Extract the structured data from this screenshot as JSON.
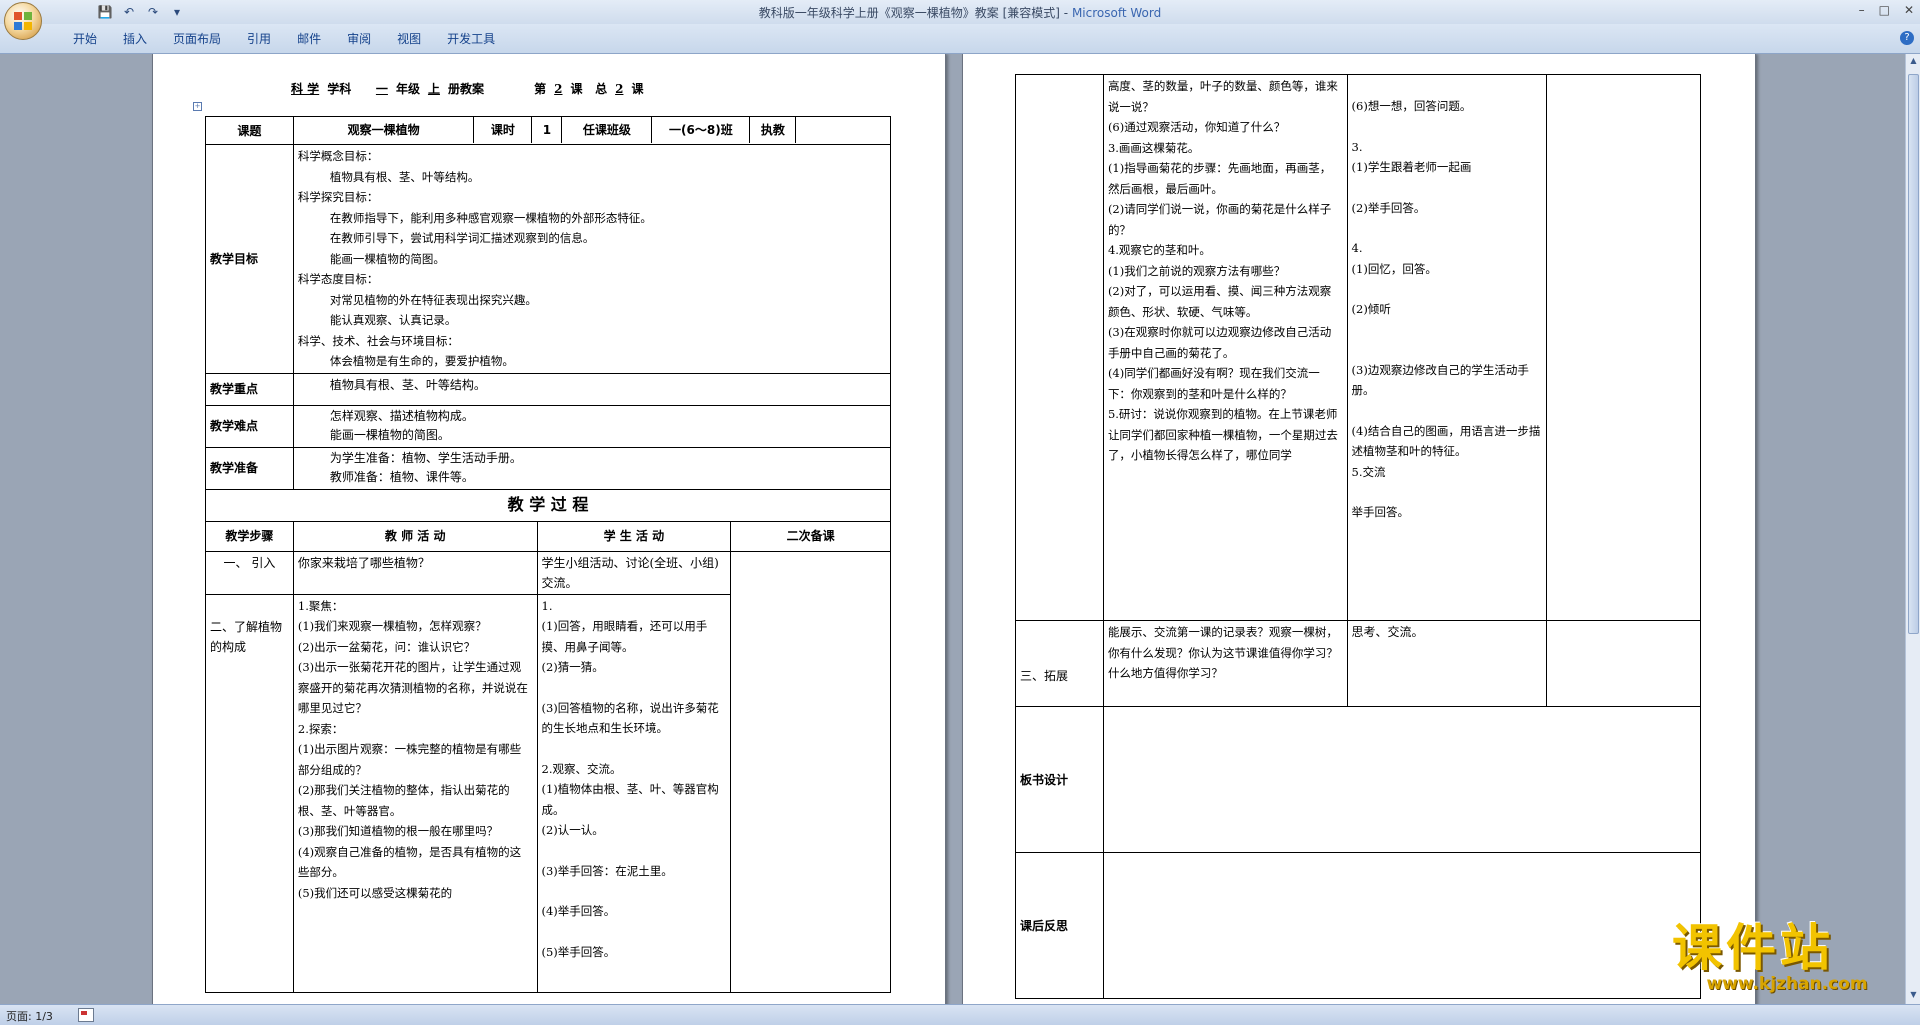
{
  "window": {
    "title_doc": "教科版一年级科学上册《观察一棵植物》教案 [兼容模式]",
    "title_sep": " - ",
    "title_app": "Microsoft Word",
    "minimize": "–",
    "maximize": "□",
    "close": "✕"
  },
  "qat": {
    "save": "💾",
    "undo": "↶",
    "redo": "↷",
    "more": "▾"
  },
  "ribbon": {
    "tabs": [
      "开始",
      "插入",
      "页面布局",
      "引用",
      "邮件",
      "审阅",
      "视图",
      "开发工具"
    ],
    "help": "?"
  },
  "doc_header": {
    "subject": "科 学",
    "subject_label": "学科",
    "grade": "一",
    "grade_label": "年级",
    "term": "上",
    "term_label": "册教案",
    "lesson_prefix": "第",
    "lesson_no": "2",
    "lesson_label": "课",
    "total_prefix": "总",
    "total_no": "2",
    "total_label": "课"
  },
  "table1": {
    "topic_label": "课题",
    "topic": "观察一棵植物",
    "hours_label": "课时",
    "hours": "1",
    "class_label": "任课班级",
    "class": "一(6～8)班",
    "teacher_label": "执教",
    "goals_label": "教学目标",
    "goals": [
      {
        "text": "科学概念目标：",
        "indent": false
      },
      {
        "text": "植物具有根、茎、叶等结构。",
        "indent": true
      },
      {
        "text": "科学探究目标：",
        "indent": false
      },
      {
        "text": "在教师指导下，能利用多种感官观察一棵植物的外部形态特征。",
        "indent": true
      },
      {
        "text": "在教师引导下，尝试用科学词汇描述观察到的信息。",
        "indent": true
      },
      {
        "text": "能画一棵植物的简图。",
        "indent": true
      },
      {
        "text": "科学态度目标：",
        "indent": false
      },
      {
        "text": "对常见植物的外在特征表现出探究兴趣。",
        "indent": true
      },
      {
        "text": "能认真观察、认真记录。",
        "indent": true
      },
      {
        "text": "科学、技术、社会与环境目标：",
        "indent": false
      },
      {
        "text": "体会植物是有生命的，要爱护植物。",
        "indent": true
      }
    ],
    "key_label": "教学重点",
    "key": [
      "植物具有根、茎、叶等结构。"
    ],
    "difficult_label": "教学难点",
    "difficult": [
      "怎样观察、描述植物构成。",
      "能画一棵植物的简图。"
    ],
    "prep_label": "教学准备",
    "prep": [
      "为学生准备：植物、学生活动手册。",
      "教师准备：植物、课件等。"
    ],
    "process_title": "教 学 过 程",
    "col_step": "教学步骤",
    "col_teacher": "教 师 活 动",
    "col_student": "学 生 活 动",
    "col_revise": "二次备课",
    "step1_label": "一、 引入",
    "step1_teacher": [
      "你家来栽培了哪些植物？"
    ],
    "step1_student": [
      "学生小组活动、讨论(全班、小组)交流。"
    ],
    "step2_label": "二、了解植物的构成",
    "step2_teacher": [
      "1.聚焦：",
      "(1)我们来观察一棵植物，怎样观察？",
      "(2)出示一盆菊花，问：谁认识它？",
      "(3)出示一张菊花开花的图片，让学生通过观察盛开的菊花再次猜测植物的名称，并说说在哪里见过它？",
      "2.探索：",
      "(1)出示图片观察：一株完整的植物是有哪些部分组成的？",
      "(2)那我们关注植物的整体，指认出菊花的根、茎、叶等器官。",
      "(3)那我们知道植物的根一般在哪里吗？",
      "(4)观察自己准备的植物，是否具有植物的这些部分。",
      "(5)我们还可以感受这棵菊花的"
    ],
    "step2_student": [
      "1.",
      "(1)回答，用眼睛看，还可以用手摸、用鼻子闻等。",
      "(2)猜一猜。",
      "",
      "(3)回答植物的名称，说出许多菊花的生长地点和生长环境。",
      "",
      "2.观察、交流。",
      "(1)植物体由根、茎、叶、等器官构成。",
      "(2)认一认。",
      "",
      "(3)举手回答：在泥土里。",
      "",
      "(4)举手回答。",
      "",
      "(5)举手回答。"
    ]
  },
  "table2": {
    "cont_teacher": [
      "高度、茎的数量，叶子的数量、颜色等，谁来说一说？",
      "(6)通过观察活动，你知道了什么？",
      "3.画画这棵菊花。",
      "(1)指导画菊花的步骤：先画地面，再画茎，然后画根，最后画叶。",
      "(2)请同学们说一说，你画的菊花是什么样子的？",
      "4.观察它的茎和叶。",
      "(1)我们之前说的观察方法有哪些？",
      "(2)对了，可以运用看、摸、闻三种方法观察颜色、形状、软硬、气味等。",
      "(3)在观察时你就可以边观察边修改自己活动手册中自己画的菊花了。",
      "(4)同学们都画好没有啊？现在我们交流一下：你观察到的茎和叶是什么样的？",
      "5.研讨：说说你观察到的植物。在上节课老师让同学们都回家种植一棵植物，一个星期过去了，小植物长得怎么样了，哪位同学"
    ],
    "cont_student": [
      "",
      "(6)想一想，回答问题。",
      "3.",
      "(1)学生跟着老师一起画",
      "(2)举手回答。",
      "4.",
      "(1)回忆，回答。",
      "(2)倾听",
      "",
      "(3)边观察边修改自己的学生活动手册。",
      "(4)结合自己的图画，用语言进一步描述植物茎和叶的特征。",
      "5.交流",
      "举手回答。"
    ],
    "step3_label": "三、拓展",
    "step3_teacher": [
      "能展示、交流第一课的记录表？观察一棵树，你有什么发现？你认为这节课谁值得你学习？什么地方值得你学习？"
    ],
    "step3_student": [
      "思考、交流。"
    ],
    "board_label": "板书设计",
    "reflect_label": "课后反思"
  },
  "status": {
    "page": "页面: 1/3"
  },
  "watermark": {
    "text": "课件站",
    "url": "www.kjzhan.com"
  },
  "colors": {
    "ribbon": "#c7d7eb",
    "workspace": "#9aa5b5",
    "watermark": "#f2c300",
    "title_app": "#3a66b0"
  }
}
